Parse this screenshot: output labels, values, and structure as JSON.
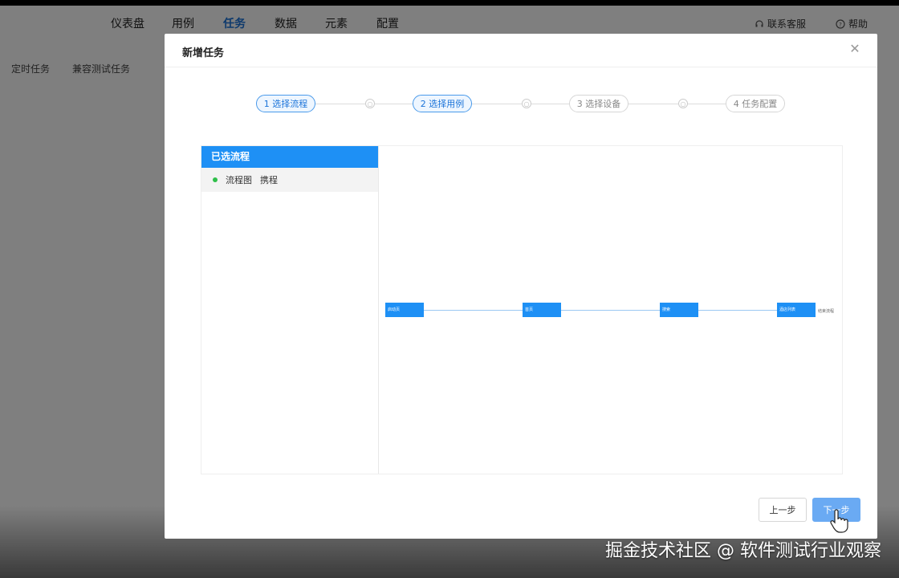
{
  "topnav": {
    "items": [
      "仪表盘",
      "用例",
      "任务",
      "数据",
      "元素",
      "配置"
    ],
    "active_index": 2,
    "support": "联系客服",
    "help": "帮助"
  },
  "subnav": {
    "items": [
      "定时任务",
      "兼容测试任务"
    ]
  },
  "modal": {
    "title": "新增任务",
    "steps": [
      {
        "label": "1 选择流程",
        "active": true
      },
      {
        "label": "2 选择用例",
        "active": true
      },
      {
        "label": "3 选择设备",
        "active": false
      },
      {
        "label": "4 任务配置",
        "active": false
      }
    ],
    "left_panel": {
      "header": "已选流程",
      "items": [
        {
          "name": "流程图",
          "value": "携程"
        }
      ]
    },
    "diagram": {
      "nodes": [
        "启动页",
        "首页",
        "搜索",
        "酒店列表"
      ],
      "end_label": "结束流程"
    },
    "buttons": {
      "prev": "上一步",
      "next": "下一步"
    }
  },
  "colors": {
    "primary": "#1e90f5",
    "active_text": "#1a73d9",
    "next_button": "#6aaaf3",
    "status_dot": "#2fbf4a"
  },
  "watermark": "掘金技术社区 @ 软件测试行业观察"
}
